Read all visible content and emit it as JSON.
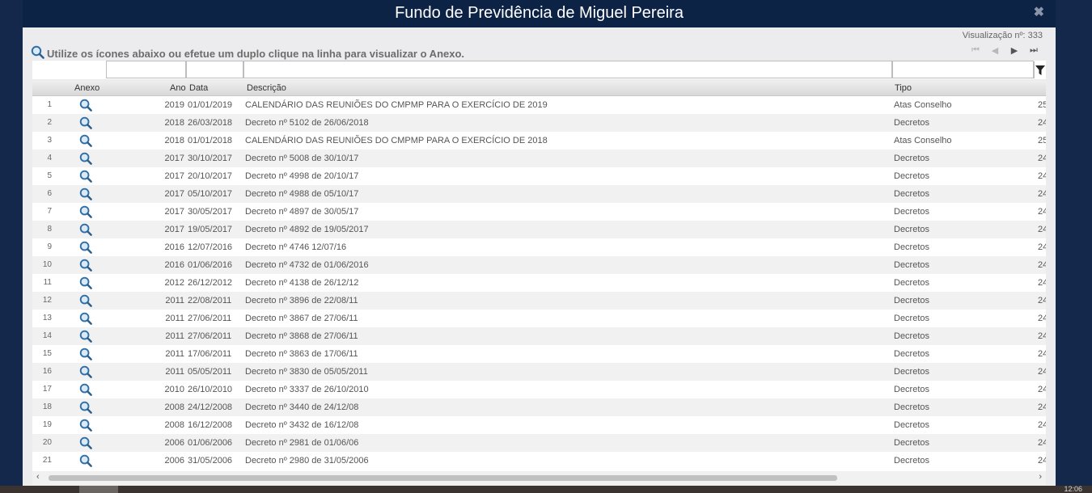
{
  "window": {
    "title": "Fundo de Previdência de Miguel Pereira",
    "close_label": "✖"
  },
  "counter": "Visualização nº: 333",
  "instruction": "Utilize os ícones abaixo ou efetue um duplo clique na linha para visualizar o Anexo.",
  "pager": {
    "first": "⏮",
    "prev": "◀",
    "next": "▶",
    "last": "⏭"
  },
  "columns": {
    "anexo": "Anexo",
    "ano": "Ano",
    "data": "Data",
    "descricao": "Descrição",
    "tipo": "Tipo"
  },
  "rows": [
    {
      "n": "1",
      "ano": "2019",
      "data": "01/01/2019",
      "desc": "CALENDÁRIO DAS REUNIÕES DO CMPMP PARA O EXERCÍCIO DE 2019",
      "tipo": "Atas Conselho",
      "extra": "25"
    },
    {
      "n": "2",
      "ano": "2018",
      "data": "26/03/2018",
      "desc": "Decreto nº 5102 de 26/06/2018",
      "tipo": "Decretos",
      "extra": "24"
    },
    {
      "n": "3",
      "ano": "2018",
      "data": "01/01/2018",
      "desc": "CALENDÁRIO DAS REUNIÕES DO CMPMP PARA O EXERCÍCIO DE 2018",
      "tipo": "Atas Conselho",
      "extra": "25"
    },
    {
      "n": "4",
      "ano": "2017",
      "data": "30/10/2017",
      "desc": "Decreto nº 5008 de 30/10/17",
      "tipo": "Decretos",
      "extra": "24"
    },
    {
      "n": "5",
      "ano": "2017",
      "data": "20/10/2017",
      "desc": "Decreto nº 4998 de 20/10/17",
      "tipo": "Decretos",
      "extra": "24"
    },
    {
      "n": "6",
      "ano": "2017",
      "data": "05/10/2017",
      "desc": "Decreto nº 4988 de 05/10/17",
      "tipo": "Decretos",
      "extra": "24"
    },
    {
      "n": "7",
      "ano": "2017",
      "data": "30/05/2017",
      "desc": "Decreto nº 4897 de 30/05/17",
      "tipo": "Decretos",
      "extra": "24"
    },
    {
      "n": "8",
      "ano": "2017",
      "data": "19/05/2017",
      "desc": "Decreto nº 4892 de 19/05/2017",
      "tipo": "Decretos",
      "extra": "24"
    },
    {
      "n": "9",
      "ano": "2016",
      "data": "12/07/2016",
      "desc": "Decreto nº 4746 12/07/16",
      "tipo": "Decretos",
      "extra": "24"
    },
    {
      "n": "10",
      "ano": "2016",
      "data": "01/06/2016",
      "desc": "Decreto nº 4732 de 01/06/2016",
      "tipo": "Decretos",
      "extra": "24"
    },
    {
      "n": "11",
      "ano": "2012",
      "data": "26/12/2012",
      "desc": "Decreto nº 4138 de 26/12/12",
      "tipo": "Decretos",
      "extra": "24"
    },
    {
      "n": "12",
      "ano": "2011",
      "data": "22/08/2011",
      "desc": "Decreto nº 3896 de 22/08/11",
      "tipo": "Decretos",
      "extra": "24"
    },
    {
      "n": "13",
      "ano": "2011",
      "data": "27/06/2011",
      "desc": "Decreto nº 3867 de 27/06/11",
      "tipo": "Decretos",
      "extra": "24"
    },
    {
      "n": "14",
      "ano": "2011",
      "data": "27/06/2011",
      "desc": "Decreto nº 3868 de 27/06/11",
      "tipo": "Decretos",
      "extra": "24"
    },
    {
      "n": "15",
      "ano": "2011",
      "data": "17/06/2011",
      "desc": "Decreto nº 3863 de 17/06/11",
      "tipo": "Decretos",
      "extra": "24"
    },
    {
      "n": "16",
      "ano": "2011",
      "data": "05/05/2011",
      "desc": "Decreto nº 3830 de 05/05/2011",
      "tipo": "Decretos",
      "extra": "24"
    },
    {
      "n": "17",
      "ano": "2010",
      "data": "26/10/2010",
      "desc": "Decreto nº 3337 de 26/10/2010",
      "tipo": "Decretos",
      "extra": "24"
    },
    {
      "n": "18",
      "ano": "2008",
      "data": "24/12/2008",
      "desc": "Decreto nº 3440 de 24/12/08",
      "tipo": "Decretos",
      "extra": "24"
    },
    {
      "n": "19",
      "ano": "2008",
      "data": "16/12/2008",
      "desc": "Decreto nº 3432 de 16/12/08",
      "tipo": "Decretos",
      "extra": "24"
    },
    {
      "n": "20",
      "ano": "2006",
      "data": "01/06/2006",
      "desc": "Decreto nº 2981 de 01/06/06",
      "tipo": "Decretos",
      "extra": "24"
    },
    {
      "n": "21",
      "ano": "2006",
      "data": "31/05/2006",
      "desc": "Decreto nº 2980 de 31/05/2006",
      "tipo": "Decretos",
      "extra": "24"
    }
  ],
  "scroll": {
    "left": "‹",
    "right": "›"
  },
  "taskbar": {
    "clock": "12:06"
  },
  "colors": {
    "header_bg": "#0d2346",
    "page_bg": "#0f2443",
    "row_alt": "#f1f1f1"
  },
  "icons": {
    "view_attachment": "magnifier-icon",
    "filter": "filter-icon"
  }
}
